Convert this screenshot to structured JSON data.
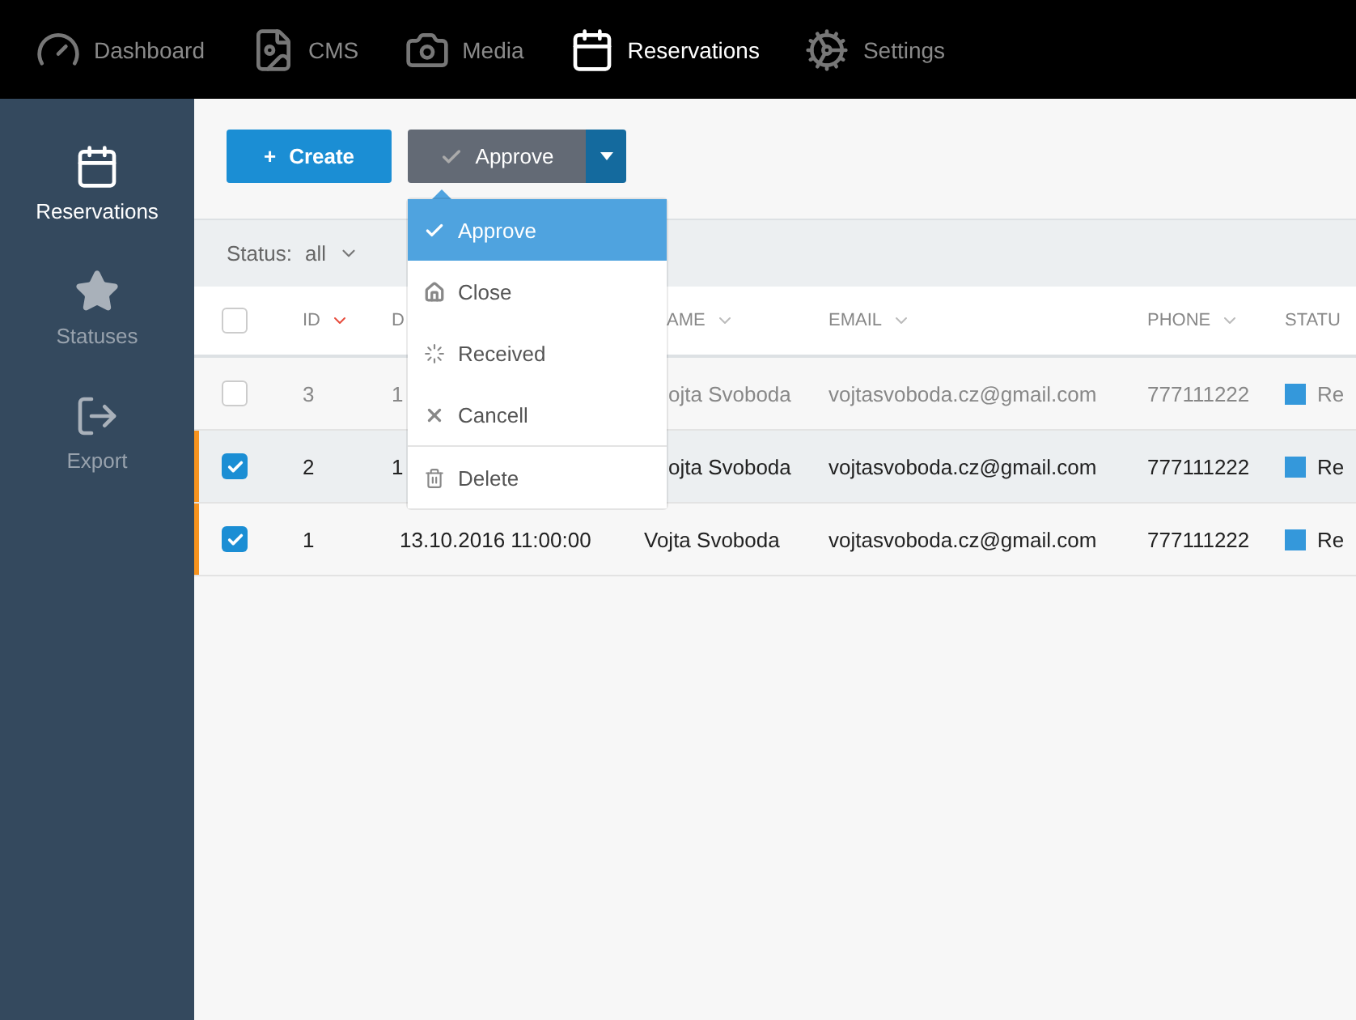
{
  "top_nav": [
    {
      "label": "Dashboard",
      "selected": false
    },
    {
      "label": "CMS",
      "selected": false
    },
    {
      "label": "Media",
      "selected": false
    },
    {
      "label": "Reservations",
      "selected": true
    },
    {
      "label": "Settings",
      "selected": false
    }
  ],
  "sidebar": {
    "items": [
      {
        "label": "Reservations",
        "selected": true
      },
      {
        "label": "Statuses",
        "selected": false
      },
      {
        "label": "Export",
        "selected": false
      }
    ]
  },
  "toolbar": {
    "create_button": {
      "icon": "+",
      "label": "Create"
    },
    "approve_button": {
      "label": "Approve"
    }
  },
  "action_menu": {
    "items": [
      {
        "label": "Approve",
        "selected": true
      },
      {
        "label": "Close",
        "selected": false
      },
      {
        "label": "Received",
        "selected": false
      },
      {
        "label": "Cancell",
        "selected": false
      },
      {
        "label": "Delete",
        "selected": false
      }
    ]
  },
  "filter": {
    "label": "Status:",
    "value": "all"
  },
  "table": {
    "select_all": {
      "checked": false
    },
    "columns": [
      {
        "label": "ID",
        "sorted": true
      },
      {
        "label": "D"
      },
      {
        "label": "AME",
        "sorted": false
      },
      {
        "label": "EMAIL",
        "sorted": false
      },
      {
        "label": "PHONE",
        "sorted": false
      },
      {
        "label": "STATU"
      }
    ],
    "rows": [
      {
        "selected": false,
        "id": "3",
        "date": "1",
        "name": "ojta Svoboda",
        "email": "vojtasvoboda.cz@gmail.com",
        "phone": "777111222",
        "status": "Re",
        "color": "#3498db"
      },
      {
        "selected": true,
        "id": "2",
        "date": "1",
        "name": "ojta Svoboda",
        "email": "vojtasvoboda.cz@gmail.com",
        "phone": "777111222",
        "status": "Re",
        "color": "#3498db"
      },
      {
        "selected": true,
        "id": "1",
        "date": "13.10.2016 11:00:00",
        "name": "Vojta Svoboda",
        "email": "vojtasvoboda.cz@gmail.com",
        "phone": "777111222",
        "status": "Re",
        "color": "#3498db"
      }
    ]
  }
}
